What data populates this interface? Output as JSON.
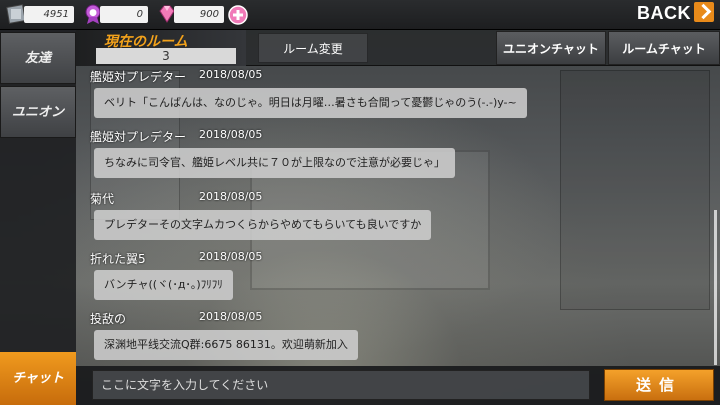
{
  "top": {
    "res1": "4951",
    "res2": "0",
    "res3": "900",
    "back_label": "BACK"
  },
  "header": {
    "room_title": "現在のルーム",
    "room_number": "3",
    "change_room": "ルーム変更",
    "union_chat": "ユニオンチャット",
    "room_chat": "ルームチャット"
  },
  "sidebar": {
    "friends": "友達",
    "union": "ユニオン",
    "chat": "チャット"
  },
  "messages": [
    {
      "name": "艦姫対プレデター",
      "date": "2018/08/05",
      "text": "ベリト「こんばんは、なのじゃ。明日は月曜…暑さも合間って憂鬱じゃのう(-.-)y-~"
    },
    {
      "name": "艦姫対プレデター",
      "date": "2018/08/05",
      "text": "ちなみに司令官、艦姫レベル共に７０が上限なので注意が必要じゃ」"
    },
    {
      "name": "菊代",
      "date": "2018/08/05",
      "text": "プレデターその文字ムカつくらからやめてもらいても良いですか"
    },
    {
      "name": "折れた翼5",
      "date": "2018/08/05",
      "text": "バンチャ((ヾ(･д･｡)ﾌﾘﾌﾘ"
    },
    {
      "name": "投敌の",
      "date": "2018/08/05",
      "text": "深渊地平线交流Q群:6675  86131。欢迎萌新加入"
    }
  ],
  "input": {
    "placeholder": "ここに文字を入力してください",
    "send_label": "送信"
  }
}
